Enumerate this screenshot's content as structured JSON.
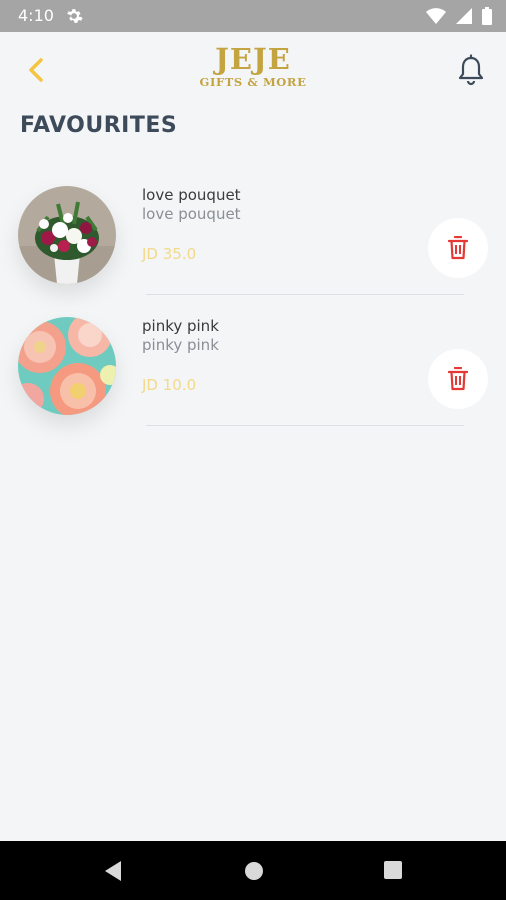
{
  "status_bar": {
    "time": "4:10"
  },
  "header": {
    "logo_line1": "JEJE",
    "logo_line2": "GIFTS & MORE"
  },
  "page": {
    "title": "FAVOURITES"
  },
  "favourites": [
    {
      "name": "love pouquet",
      "description": "love pouquet",
      "price": "JD 35.0"
    },
    {
      "name": "pinky pink",
      "description": "pinky pink",
      "price": "JD 10.0"
    }
  ],
  "colors": {
    "accent": "#f5c542",
    "delete": "#e53935",
    "title": "#3d4a5a"
  }
}
